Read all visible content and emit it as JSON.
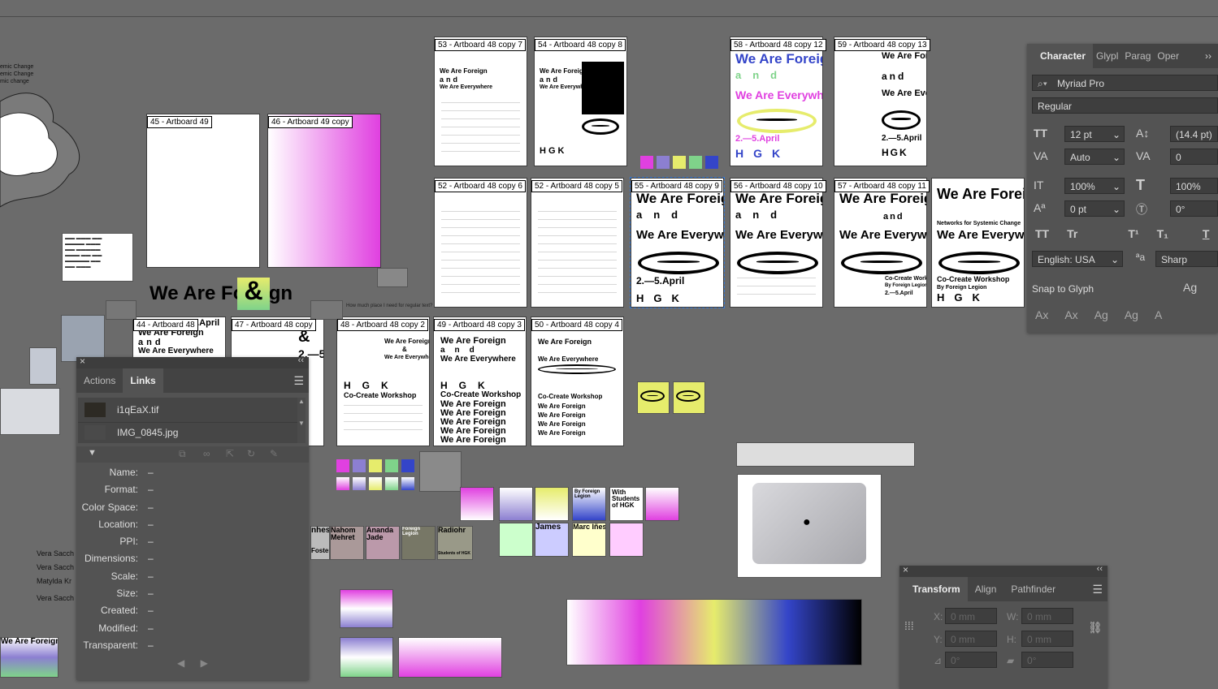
{
  "artboards": [
    {
      "label": "45 - Artboard 49"
    },
    {
      "label": "46 - Artboard 49 copy"
    },
    {
      "label": "53 - Artboard 48 copy 7"
    },
    {
      "label": "54 - Artboard 48 copy 8"
    },
    {
      "label": "58 - Artboard 48 copy 12"
    },
    {
      "label": "59 - Artboard 48 copy 13"
    },
    {
      "label": "52 - Artboard 48 copy 6"
    },
    {
      "label": "52 - Artboard 48 copy 5"
    },
    {
      "label": "55 - Artboard 48 copy 9"
    },
    {
      "label": "56 - Artboard 48 copy 10"
    },
    {
      "label": "57 - Artboard 48 copy 11"
    },
    {
      "label": "44 - Artboard 48"
    },
    {
      "label": "47 - Artboard 48 copy"
    },
    {
      "label": "48 - Artboard 48 copy 2"
    },
    {
      "label": "49 - Artboard 48 copy 3"
    },
    {
      "label": "50 - Artboard 48 copy 4"
    }
  ],
  "poster": {
    "we_are_foreign": "We Are Foreign",
    "and": "and",
    "we_are_everywhere": "We Are Everywhere",
    "date": "2.—5.April",
    "hgk": "HGK",
    "cocreate": "Co-Create Workshop",
    "networks": "Networks for Systemic Change",
    "by_legion": "By Foreign Legion",
    "ampersand": "&",
    "fiveapril": "5.April"
  },
  "canvas_text": {
    "placeholder_q": "How much place I need for regular text?",
    "systemic1": "emic Change",
    "systemic2": "emic Change",
    "systemic3": "mic change",
    "names": [
      "Vera Sacch",
      "Vera Sacch",
      "Matylda Kr",
      "Vera Sacch"
    ],
    "people": [
      "Nahom Mehret",
      "Ananda Jade",
      "Foreign Legion",
      "Radiohr"
    ],
    "nhes": "nhes",
    "foster": "Foster",
    "students": "Students of HGK",
    "marc": "Marc Iñes",
    "james": "James",
    "with_students": "With Students of HGK",
    "by_foreign": "By Foreign Legion"
  },
  "links_panel": {
    "tabs": [
      "Actions",
      "Links"
    ],
    "active_tab": "Links",
    "files": [
      "i1qEaX.tif",
      "IMG_0845.jpg"
    ],
    "info": [
      {
        "k": "Name:",
        "v": "–"
      },
      {
        "k": "Format:",
        "v": "–"
      },
      {
        "k": "Color Space:",
        "v": "–"
      },
      {
        "k": "Location:",
        "v": "–"
      },
      {
        "k": "PPI:",
        "v": "–"
      },
      {
        "k": "Dimensions:",
        "v": "–"
      },
      {
        "k": "Scale:",
        "v": "–"
      },
      {
        "k": "Size:",
        "v": "–"
      },
      {
        "k": "Created:",
        "v": "–"
      },
      {
        "k": "Modified:",
        "v": "–"
      },
      {
        "k": "Transparent:",
        "v": "–"
      }
    ]
  },
  "character_panel": {
    "tabs": [
      "Character",
      "Glypl",
      "Parag",
      "Oper"
    ],
    "font_family": "Myriad Pro",
    "font_style": "Regular",
    "font_size": "12 pt",
    "leading": "(14.4 pt)",
    "kerning": "Auto",
    "tracking": "0",
    "vscale": "100%",
    "hscale": "100%",
    "baseline": "0 pt",
    "rotation": "0°",
    "language": "English: USA",
    "aa": "Sharp",
    "snap": "Snap to Glyph",
    "caps": [
      "TT",
      "Tr",
      "T¹",
      "T₁",
      "T"
    ]
  },
  "transform_panel": {
    "tabs": [
      "Transform",
      "Align",
      "Pathfinder"
    ],
    "x_label": "X:",
    "x_val": "0 mm",
    "y_label": "Y:",
    "y_val": "0 mm",
    "w_label": "W:",
    "w_val": "0 mm",
    "h_label": "H:",
    "h_val": "0 mm",
    "angle": "0°",
    "shear": "0°"
  },
  "colors": {
    "canvas": "#6b6b6b",
    "panel": "#535353",
    "magenta": "#e040e0",
    "lavender": "#8c7fd1",
    "yellow": "#e6ec6c",
    "green": "#7fd38a",
    "blue": "#3445c9"
  }
}
